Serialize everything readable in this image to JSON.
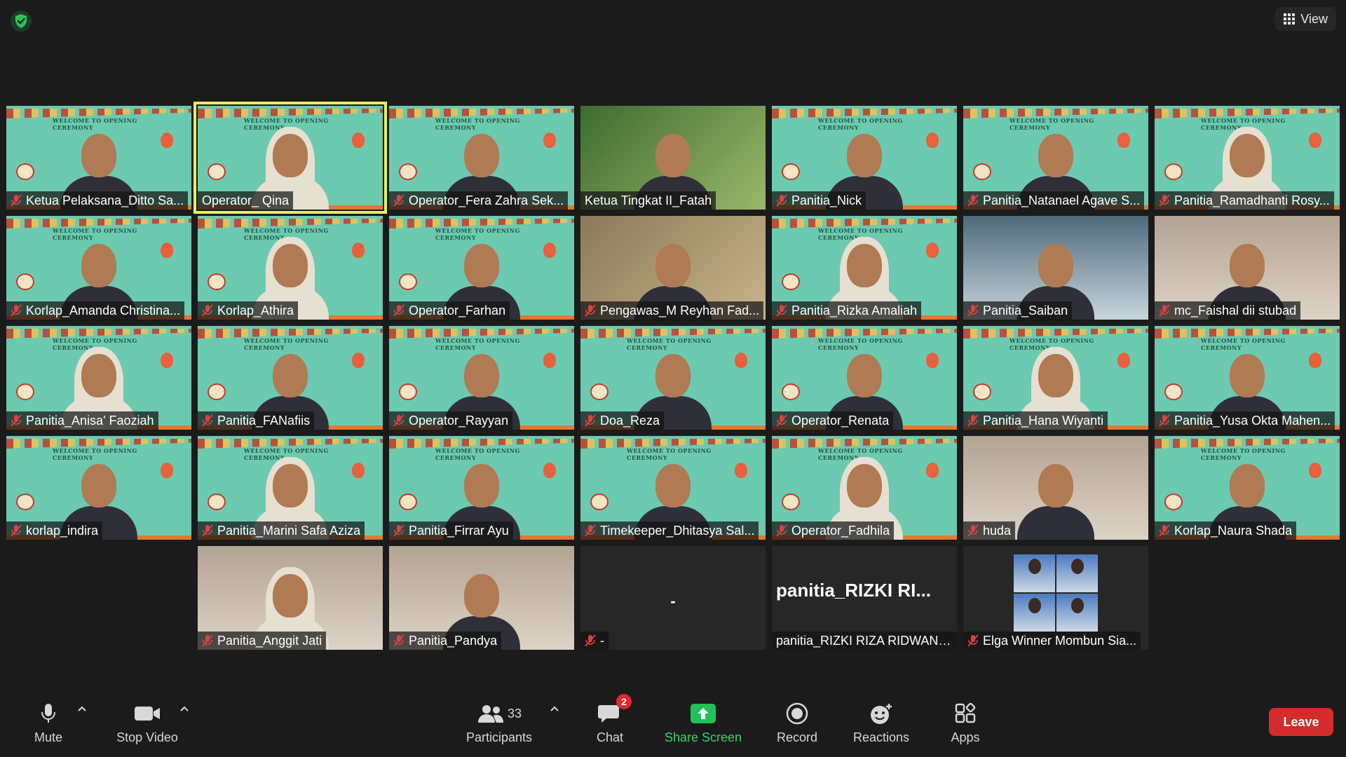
{
  "top": {
    "view_label": "View",
    "shield_icon": "shield-check-icon"
  },
  "tiles": [
    {
      "name": "Ketua Pelaksana_Ditto Sa...",
      "muted": true,
      "scene": "welcome"
    },
    {
      "name": "Operator_ Qina",
      "muted": false,
      "scene": "welcome",
      "active": true
    },
    {
      "name": "Operator_Fera Zahra Sek...",
      "muted": true,
      "scene": "welcome"
    },
    {
      "name": "Ketua Tingkat II_Fatah",
      "muted": false,
      "scene": "green-photo"
    },
    {
      "name": "Panitia_Nick",
      "muted": true,
      "scene": "welcome"
    },
    {
      "name": "Panitia_Natanael Agave S...",
      "muted": true,
      "scene": "welcome"
    },
    {
      "name": "Panitia_Ramadhanti Rosy...",
      "muted": true,
      "scene": "welcome"
    },
    {
      "name": "Korlap_Amanda Christina...",
      "muted": true,
      "scene": "welcome"
    },
    {
      "name": "Korlap_Athira",
      "muted": true,
      "scene": "welcome"
    },
    {
      "name": "Operator_Farhan",
      "muted": true,
      "scene": "welcome"
    },
    {
      "name": "Pengawas_M Reyhan Fad...",
      "muted": true,
      "scene": "photo"
    },
    {
      "name": "Panitia_Rizka Amaliah",
      "muted": true,
      "scene": "welcome"
    },
    {
      "name": "Panitia_Saiban",
      "muted": true,
      "scene": "blue-room"
    },
    {
      "name": "mc_Faishal dii stubad",
      "muted": true,
      "scene": "room"
    },
    {
      "name": "Panitia_Anisa' Faoziah",
      "muted": true,
      "scene": "welcome"
    },
    {
      "name": "Panitia_FANafiis",
      "muted": true,
      "scene": "welcome"
    },
    {
      "name": "Operator_Rayyan",
      "muted": true,
      "scene": "welcome"
    },
    {
      "name": "Doa_Reza",
      "muted": true,
      "scene": "welcome"
    },
    {
      "name": "Operator_Renata",
      "muted": true,
      "scene": "welcome"
    },
    {
      "name": "Panitia_Hana Wiyanti",
      "muted": true,
      "scene": "welcome"
    },
    {
      "name": "Panitia_Yusa Okta Mahen...",
      "muted": true,
      "scene": "welcome"
    },
    {
      "name": "korlap_indira",
      "muted": true,
      "scene": "welcome"
    },
    {
      "name": "Panitia_Marini Safa Aziza",
      "muted": true,
      "scene": "welcome"
    },
    {
      "name": "Panitia_Firrar Ayu",
      "muted": true,
      "scene": "welcome"
    },
    {
      "name": "Timekeeper_Dhitasya Sal...",
      "muted": true,
      "scene": "welcome"
    },
    {
      "name": "Operator_Fadhila",
      "muted": true,
      "scene": "welcome"
    },
    {
      "name": "huda",
      "muted": true,
      "scene": "room"
    },
    {
      "name": "Korlap_Naura Shada",
      "muted": true,
      "scene": "welcome"
    },
    {
      "name": "",
      "muted": false,
      "scene": "empty"
    },
    {
      "name": "Panitia_Anggit Jati",
      "muted": true,
      "scene": "room"
    },
    {
      "name": "Panitia_Pandya",
      "muted": true,
      "scene": "room"
    },
    {
      "name": "-",
      "muted": true,
      "scene": "dash",
      "center_text": "-"
    },
    {
      "name": "panitia_RIZKI RIZA RIDWANS...",
      "muted": false,
      "scene": "text",
      "big_text": "panitia_RIZKI  RI..."
    },
    {
      "name": "Elga Winner Mombun Sia...",
      "muted": true,
      "scene": "collage"
    },
    {
      "name": "",
      "muted": false,
      "scene": "empty"
    }
  ],
  "welcome_banner": "WELCOME TO OPENING CEREMONY",
  "toolbar": {
    "mute_label": "Mute",
    "stop_video_label": "Stop Video",
    "participants_label": "Participants",
    "participants_count": "33",
    "chat_label": "Chat",
    "chat_badge": "2",
    "share_label": "Share Screen",
    "record_label": "Record",
    "reactions_label": "Reactions",
    "apps_label": "Apps",
    "leave_label": "Leave"
  },
  "colors": {
    "background": "#1b1b1b",
    "active_speaker": "#e4f15a",
    "share_green": "#3ad36b",
    "leave_red": "#d62b2b",
    "muted_red": "#e04040"
  }
}
